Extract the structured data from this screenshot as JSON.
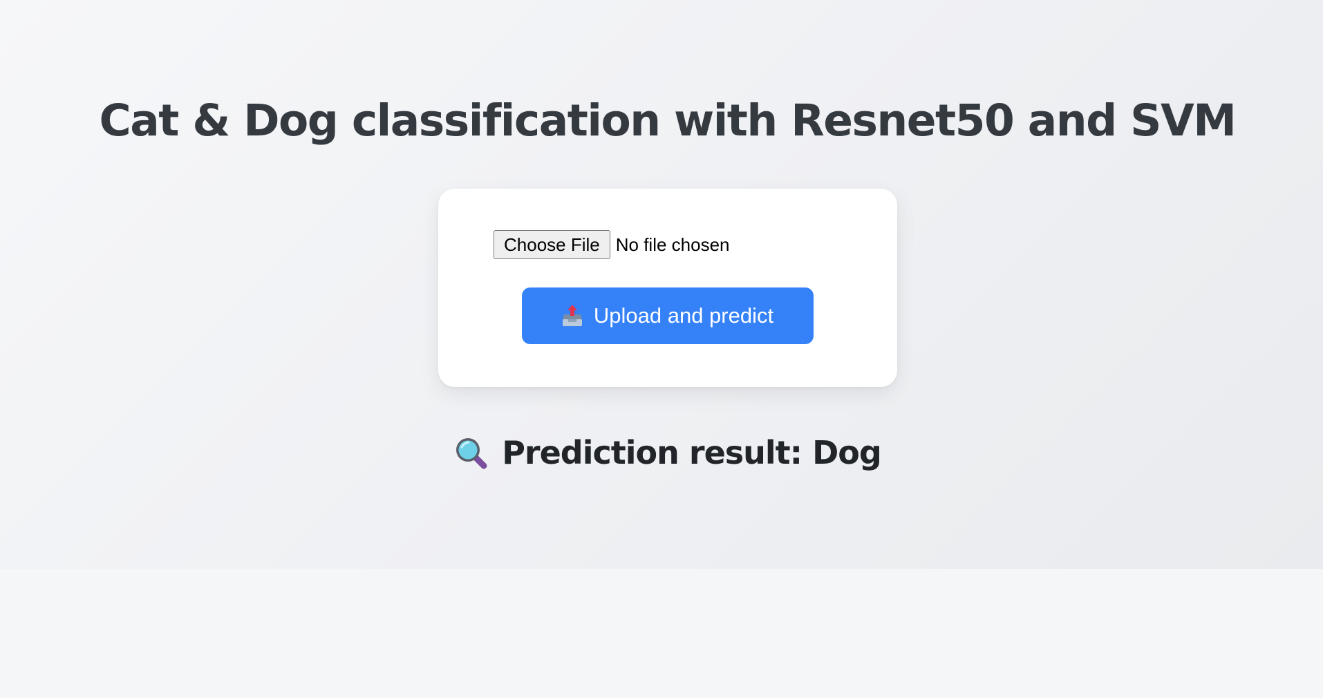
{
  "page": {
    "title": "Cat & Dog classification with Resnet50 and SVM"
  },
  "upload_form": {
    "choose_file_label": "Choose File",
    "file_status": "No file chosen",
    "submit_label": "Upload and predict",
    "submit_icon": "outbox-tray-icon"
  },
  "result": {
    "icon": "magnifier-icon",
    "text": "Prediction result: Dog"
  },
  "colors": {
    "accent": "#3581f8",
    "title_text": "#343a40",
    "result_text": "#212529",
    "card_background": "#ffffff",
    "page_background": "#f5f6f8"
  }
}
